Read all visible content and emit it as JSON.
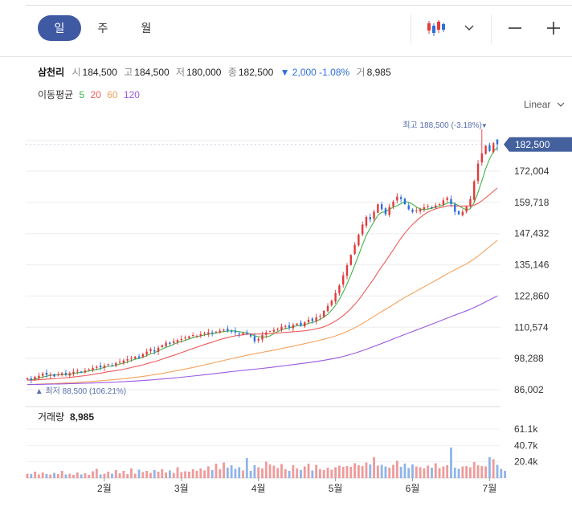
{
  "periods": [
    "일",
    "주",
    "월"
  ],
  "active_period": "일",
  "stock": {
    "name": "삼천리",
    "open_label": "시",
    "open": "184,500",
    "high_label": "고",
    "high": "184,500",
    "low_label": "저",
    "low": "180,000",
    "close_label": "종",
    "close": "182,500",
    "change": "▼ 2,000 -1.08%",
    "volume_label": "거",
    "volume": "8,985"
  },
  "ma": {
    "label": "이동평균",
    "periods": [
      "5",
      "20",
      "60",
      "120"
    ],
    "colors": [
      "#3db54a",
      "#ef5b5b",
      "#f5a25b",
      "#9b59e0"
    ]
  },
  "scale_mode": "Linear",
  "colors": {
    "up": "#e23b3b",
    "down": "#2f6fd8",
    "accent": "#3f5aa3",
    "badge": "#44619e"
  },
  "chart_data": {
    "type": "candlestick",
    "y_ticks": [
      "172,004",
      "159,718",
      "147,432",
      "135,146",
      "122,860",
      "110,574",
      "98,288",
      "86,002"
    ],
    "y_tick_values": [
      172004,
      159718,
      147432,
      135146,
      122860,
      110574,
      98288,
      86002
    ],
    "x_ticks": [
      "2월",
      "3월",
      "4월",
      "5월",
      "6월",
      "7월"
    ],
    "x_tick_index": [
      20,
      40,
      60,
      80,
      100,
      120
    ],
    "current_price_label": "182,500",
    "current_price": 182500,
    "high_label": "최고 188,500 (-3.18%)",
    "high_marker": "▼",
    "high_index": 118,
    "high_value": 188500,
    "low_label": "최저 88,500 (106.21%)",
    "low_marker": "▲",
    "low_index": 1,
    "low_value": 88500,
    "volume_title": "거래량",
    "volume_value": "8,985",
    "volume_ticks": [
      "61.1k",
      "40.7k",
      "20.4k"
    ],
    "volume_tick_values": [
      61100,
      40700,
      20400
    ],
    "ylim": [
      86002,
      190000
    ],
    "closes": [
      90500,
      89800,
      91000,
      91500,
      92300,
      91800,
      92000,
      91200,
      92000,
      92500,
      92000,
      92500,
      93000,
      93500,
      92800,
      93500,
      94000,
      94500,
      95000,
      94800,
      95500,
      96000,
      95500,
      96500,
      97000,
      97500,
      98000,
      98500,
      99000,
      98500,
      100000,
      101000,
      102000,
      101000,
      102500,
      103500,
      104500,
      104000,
      105000,
      105500,
      106000,
      106500,
      107000,
      107500,
      107200,
      107800,
      108200,
      108600,
      108300,
      108800,
      109200,
      109600,
      109300,
      109000,
      108500,
      107800,
      108300,
      108000,
      107000,
      105000,
      106000,
      107500,
      108500,
      109000,
      109500,
      110000,
      110800,
      111000,
      110500,
      111500,
      112000,
      111200,
      112500,
      113500,
      113000,
      114500,
      115000,
      117000,
      119000,
      121000,
      124000,
      127000,
      131000,
      135000,
      139000,
      143000,
      147000,
      151000,
      154000,
      153000,
      156000,
      159000,
      157000,
      155000,
      158000,
      160000,
      162000,
      161000,
      159000,
      157000,
      156000,
      156500,
      157000,
      157800,
      158200,
      157500,
      158500,
      159000,
      160500,
      161500,
      159000,
      156000,
      155000,
      156000,
      158000,
      161000,
      168000,
      175000,
      179000,
      182000,
      180000,
      183000,
      182500
    ],
    "volumes": [
      5500,
      5200,
      8000,
      4500,
      7000,
      5000,
      4500,
      6500,
      5000,
      9000,
      4500,
      5500,
      4000,
      7000,
      4500,
      6000,
      4000,
      8500,
      11500,
      4500,
      5500,
      8000,
      5500,
      10000,
      6000,
      9000,
      5000,
      12000,
      5500,
      10500,
      7500,
      9000,
      6500,
      10000,
      8000,
      11000,
      7000,
      9500,
      6500,
      13500,
      7500,
      8500,
      8000,
      11000,
      9000,
      12000,
      9500,
      14500,
      10000,
      18000,
      11000,
      19500,
      13000,
      16000,
      11500,
      13500,
      9500,
      25000,
      9000,
      16000,
      13500,
      12000,
      20500,
      17000,
      15500,
      12500,
      17500,
      11000,
      9000,
      16000,
      12000,
      10000,
      14500,
      18000,
      9500,
      16500,
      11000,
      10000,
      13000,
      10500,
      13500,
      15500,
      14000,
      15000,
      14000,
      18500,
      16000,
      15000,
      19500,
      17000,
      26000,
      15500,
      16500,
      14500,
      13000,
      16500,
      21500,
      14000,
      18000,
      12500,
      17000,
      14500,
      13500,
      12000,
      15500,
      13000,
      18500,
      12500,
      14500,
      16000,
      38000,
      13000,
      11500,
      14500,
      15000,
      13500,
      20000,
      16000,
      15000,
      14500,
      26000,
      23500,
      16500,
      11500,
      8985
    ]
  }
}
